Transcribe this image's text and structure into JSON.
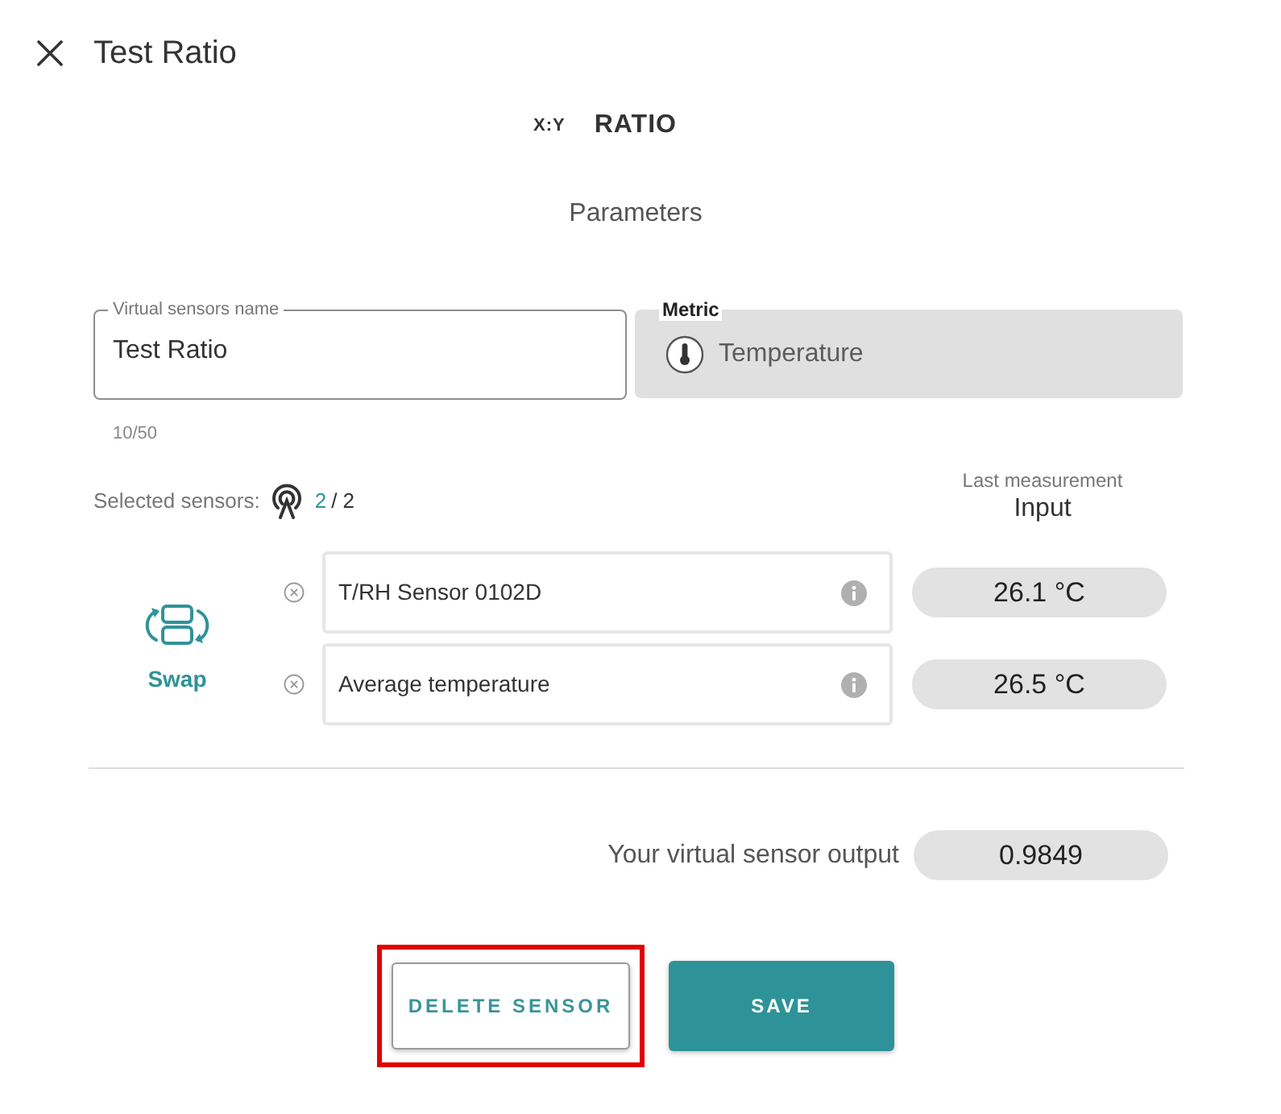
{
  "header": {
    "title": "Test Ratio"
  },
  "sensor_type": {
    "icon_text": "X:Y",
    "label": "RATIO"
  },
  "section_title": "Parameters",
  "name_field": {
    "label": "Virtual sensors name",
    "value": "Test Ratio",
    "counter": "10/50"
  },
  "metric_field": {
    "label": "Metric",
    "value": "Temperature",
    "disabled": true
  },
  "selected_sensors": {
    "label": "Selected sensors:",
    "count": "2",
    "total": "/ 2"
  },
  "measurement_header": {
    "caption": "Last measurement",
    "title": "Input"
  },
  "swap": {
    "label": "Swap"
  },
  "sensors": [
    {
      "name": "T/RH Sensor 0102D",
      "reading": "26.1 °C"
    },
    {
      "name": "Average temperature",
      "reading": "26.5 °C"
    }
  ],
  "output": {
    "label": "Your virtual sensor output",
    "value": "0.9849"
  },
  "buttons": [
    {
      "kind": "outline",
      "label": "DELETE SENSOR",
      "highlighted": true
    },
    {
      "kind": "filled",
      "label": "SAVE",
      "highlighted": false
    }
  ]
}
